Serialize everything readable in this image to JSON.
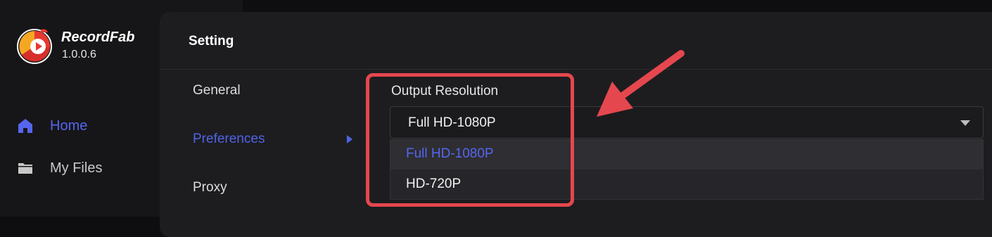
{
  "app": {
    "name": "RecordFab",
    "version": "1.0.0.6"
  },
  "sidebar": {
    "items": [
      {
        "label": "Home",
        "icon": "home-icon",
        "active": true
      },
      {
        "label": "My Files",
        "icon": "folder-icon",
        "active": false
      }
    ]
  },
  "settings": {
    "title": "Setting",
    "menu": [
      {
        "label": "General",
        "active": false
      },
      {
        "label": "Preferences",
        "active": true
      },
      {
        "label": "Proxy",
        "active": false
      }
    ],
    "output_resolution": {
      "label": "Output Resolution",
      "selected": "Full HD-1080P",
      "options": [
        "Full HD-1080P",
        "HD-720P"
      ],
      "dropdown_open": true
    }
  },
  "annotation": {
    "color": "#e5474e",
    "highlight": "output-resolution-field",
    "arrow": "pointing-to-dropdown"
  },
  "colors": {
    "accent": "#5566ee",
    "background": "#0e0e10",
    "panel": "#1d1d20"
  }
}
